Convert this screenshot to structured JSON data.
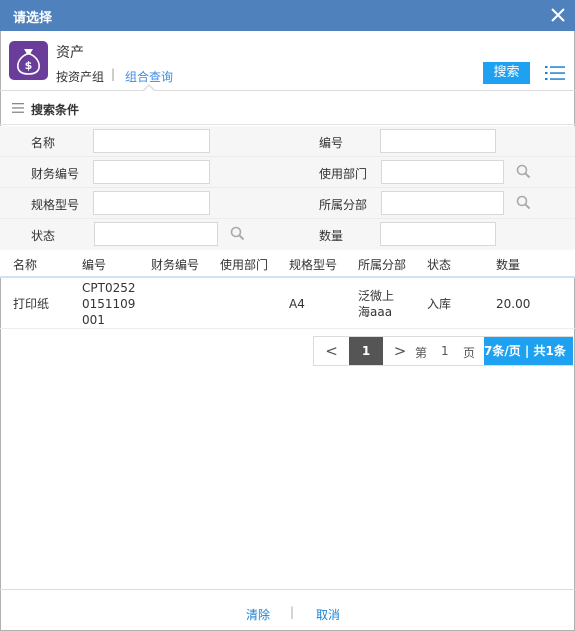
{
  "dialog": {
    "title": "请选择"
  },
  "header": {
    "app_name": "资产",
    "tabs": [
      {
        "label": "按资产组"
      },
      {
        "label": "组合查询"
      }
    ],
    "tab_separator": "|",
    "search_button": "搜索"
  },
  "conditions": {
    "label": "搜索条件"
  },
  "form": {
    "fields": [
      {
        "label": "名称",
        "value": ""
      },
      {
        "label": "编号",
        "value": ""
      },
      {
        "label": "财务编号",
        "value": ""
      },
      {
        "label": "使用部门",
        "value": ""
      },
      {
        "label": "规格型号",
        "value": ""
      },
      {
        "label": "所属分部",
        "value": ""
      },
      {
        "label": "状态",
        "value": ""
      },
      {
        "label": "数量",
        "value": ""
      }
    ]
  },
  "table": {
    "columns": [
      "名称",
      "编号",
      "财务编号",
      "使用部门",
      "规格型号",
      "所属分部",
      "状态",
      "数量"
    ],
    "rows": [
      {
        "name": "打印纸",
        "code_lines": [
          "CPT0252",
          "0151109",
          "001"
        ],
        "finance_code": "",
        "department": "",
        "spec": "A4",
        "branch_lines": [
          "泛微上",
          "海aaa"
        ],
        "status": "入库",
        "quantity": "20.00"
      }
    ]
  },
  "pagination": {
    "prev": "<",
    "current": "1",
    "next": ">",
    "di": "第",
    "page_input": "1",
    "ye": "页",
    "info": "7条/页 | 共1条"
  },
  "footer": {
    "clear": "清除",
    "separator": "|",
    "cancel": "取消"
  },
  "colors": {
    "titlebar": "#4f81bd",
    "accent": "#1ea1f1",
    "app_icon": "#6a3d9a",
    "link": "#1c82d4"
  }
}
